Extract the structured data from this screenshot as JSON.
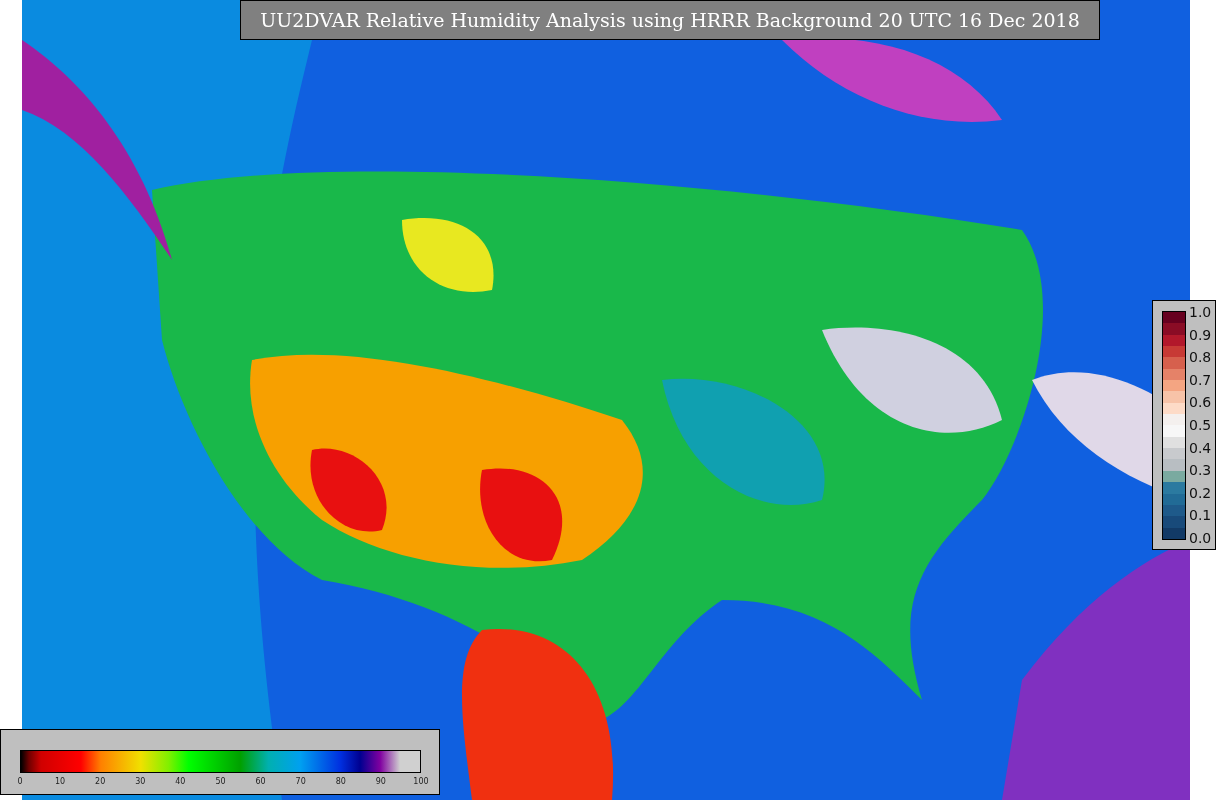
{
  "title": "UU2DVAR Relative Humidity Analysis using HRRR Background 20 UTC 16 Dec 2018",
  "colorbars": [
    {
      "kind": "vertical",
      "ticks": [
        "1.0",
        "0.9",
        "0.8",
        "0.7",
        "0.6",
        "0.5",
        "0.4",
        "0.3",
        "0.2",
        "0.1",
        "0.0"
      ]
    },
    {
      "kind": "horizontal",
      "ticks": [
        "0",
        "10",
        "20",
        "30",
        "40",
        "50",
        "60",
        "70",
        "80",
        "90",
        "100"
      ]
    }
  ]
}
